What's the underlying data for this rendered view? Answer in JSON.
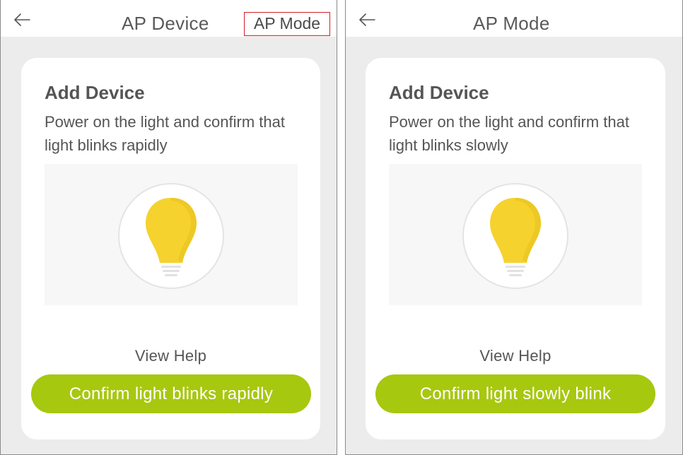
{
  "panels": [
    {
      "header": {
        "title": "AP Device",
        "mode_link": "AP Mode"
      },
      "card": {
        "title": "Add Device",
        "description": "Power on the light and confirm that light blinks rapidly",
        "view_help": "View Help",
        "confirm_button": "Confirm light blinks rapidly"
      }
    },
    {
      "header": {
        "title": "AP Mode"
      },
      "card": {
        "title": "Add Device",
        "description": "Power on the light and confirm that light blinks slowly",
        "view_help": "View Help",
        "confirm_button": "Confirm light slowly blink"
      }
    }
  ],
  "icons": [
    "back-arrow-icon",
    "light-bulb-icon"
  ],
  "colors": {
    "accent": "#a6c80f",
    "highlight_border": "#d32027",
    "bulb": "#f5d22e",
    "background": "#ececec"
  }
}
